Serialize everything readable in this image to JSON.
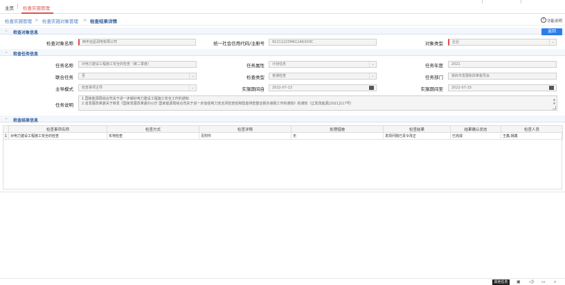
{
  "topbar": {
    "home": "主页",
    "separator": "|",
    "active_tab": "检查实施管理"
  },
  "breadcrumb": {
    "items": [
      "检查实施管理",
      "检查实施对象管理",
      "检查结果详情"
    ],
    "arrow": ">",
    "help_icon": "?",
    "help_label": "功能说明"
  },
  "sections": {
    "object": "检查对象信息",
    "task": "检查任务信息",
    "result": "检查结果信息",
    "collapse_glyph": "-"
  },
  "back_button": "返回",
  "object_info": {
    "name_label": "检查对象名称",
    "name_value": "西丰远星润电有限公司",
    "credit_label": "统一社会信用代码/注册号",
    "credit_value": "91211223MA11AKX03C",
    "type_label": "对象类型",
    "type_value": "企业"
  },
  "task_info": {
    "task_name_label": "任务名称",
    "task_name_value": "对电力建设工程施工安全的检查（第二季度）",
    "task_attr_label": "任务属性",
    "task_attr_value": "计划任务",
    "task_year_label": "任务年度",
    "task_year_value": "2021",
    "joint_label": "联合任务",
    "joint_value": "否",
    "check_type_label": "检查类型",
    "check_type_value": "普通检查",
    "dept_label": "任务部门",
    "dept_value": "铁岭市发展和改革委员会",
    "mode_label": "主导模式",
    "mode_value": "检查事项主导",
    "start_label": "实施期间自",
    "start_value": "2022-07-13",
    "end_label": "实施期间至",
    "end_value": "2022-07-15",
    "desc_label": "任务说明",
    "desc_lines": [
      "1.国家能源局综合司关于进一步做好电力建设工程施工安全工作的通知",
      "2.省发展改革委关于转发《国家发展改革委办公厅 国家能源局综合司关于进一步加强电力安全风险管控和隐患排查整治督办通报工作的通知》的通知（辽发改能源[2021]117号）"
    ]
  },
  "result_table": {
    "columns": [
      "检查事项名称",
      "检查方式",
      "检查详情",
      "处理措施",
      "检查结果",
      "结果确认状态",
      "检查人员"
    ],
    "rows": [
      {
        "index": "1",
        "cells": [
          "对电力建设工程施工安全的检查",
          "实地检查",
          "见附件",
          "无",
          "发现问题已责令改正",
          "已完成",
          "王鑫,姚鑫"
        ]
      }
    ]
  },
  "statusbar": {
    "ime": "其他任务",
    "icons": [
      "clipboard-icon",
      "volume-icon",
      "chat-icon",
      "search-icon"
    ]
  },
  "colors": {
    "accent": "#d9534f",
    "link": "#4a7cc0",
    "button": "#2b7de9"
  }
}
